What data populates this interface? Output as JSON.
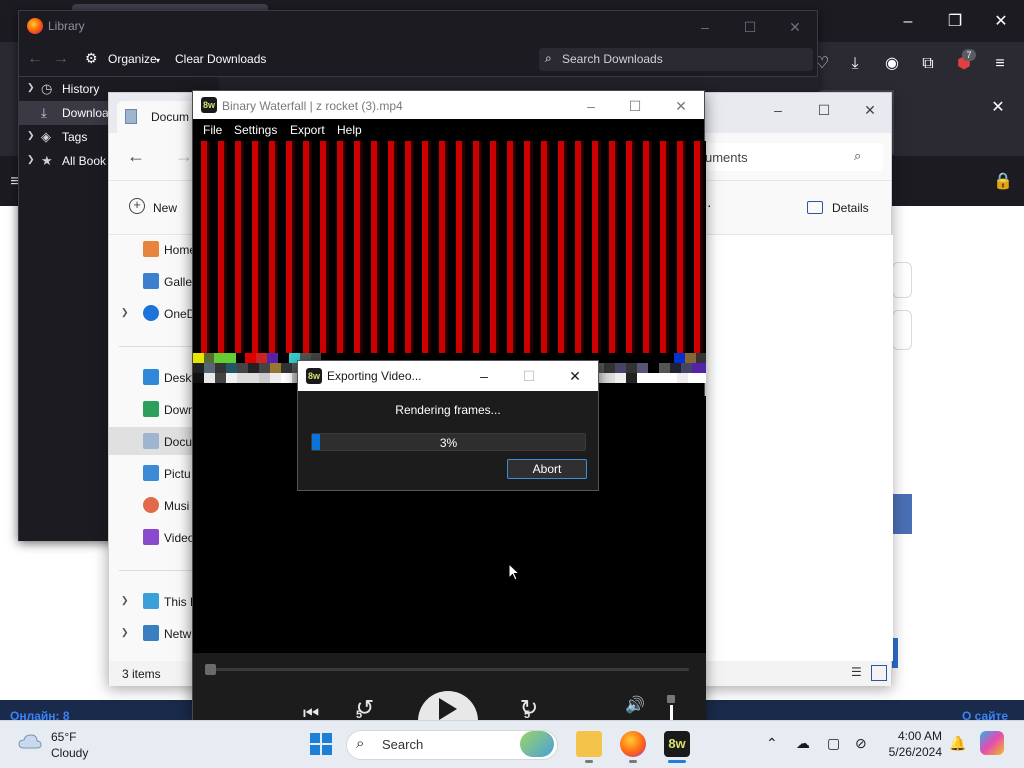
{
  "library": {
    "title": "Library",
    "organize_label": "Organize",
    "clear_downloads_label": "Clear Downloads",
    "search_placeholder": "Search Downloads",
    "sidebar": [
      {
        "label": "History",
        "icon": "clock-icon"
      },
      {
        "label": "Downloa",
        "icon": "download-icon",
        "selected": true
      },
      {
        "label": "Tags",
        "icon": "tag-icon"
      },
      {
        "label": "All Book",
        "icon": "star-icon"
      }
    ]
  },
  "explorer": {
    "tab_title": "Docum",
    "address_text": "uments",
    "new_label": "New",
    "details_label": "Details",
    "sidebar": {
      "home": "Home",
      "gallery": "Galler",
      "onedrive": "OneD",
      "desktop": "Deskt",
      "downloads": "Down",
      "documents": "Docu",
      "pictures": "Pictu",
      "music": "Musi",
      "videos": "Video",
      "thispc": "This P",
      "network": "Netw"
    },
    "status_items": "3 items"
  },
  "waterfall": {
    "title": "Binary Waterfall | z rocket (3).mp4",
    "logo": "8w",
    "menu": {
      "file": "File",
      "settings": "Settings",
      "export": "Export",
      "help": "Help"
    },
    "skip_back_label": "5",
    "skip_fwd_label": "5"
  },
  "export_dialog": {
    "title": "Exporting Video...",
    "message": "Rendering frames...",
    "progress_text": "3%",
    "progress_value": 0.03,
    "abort_label": "Abort"
  },
  "browser": {
    "notification_badge": "7",
    "bottom_text_left": "Онлайн: 8",
    "bottom_text_right": "О сайте"
  },
  "taskbar": {
    "temperature": "65°F",
    "condition": "Cloudy",
    "search_placeholder": "Search",
    "time": "4:00 AM",
    "date": "5/26/2024"
  },
  "colors": {
    "waterfall_red": "#cc0000",
    "progress_fill": "#0a74da",
    "abort_border": "#3c8ddc",
    "taskbar_bg": "#e7ecf3"
  }
}
